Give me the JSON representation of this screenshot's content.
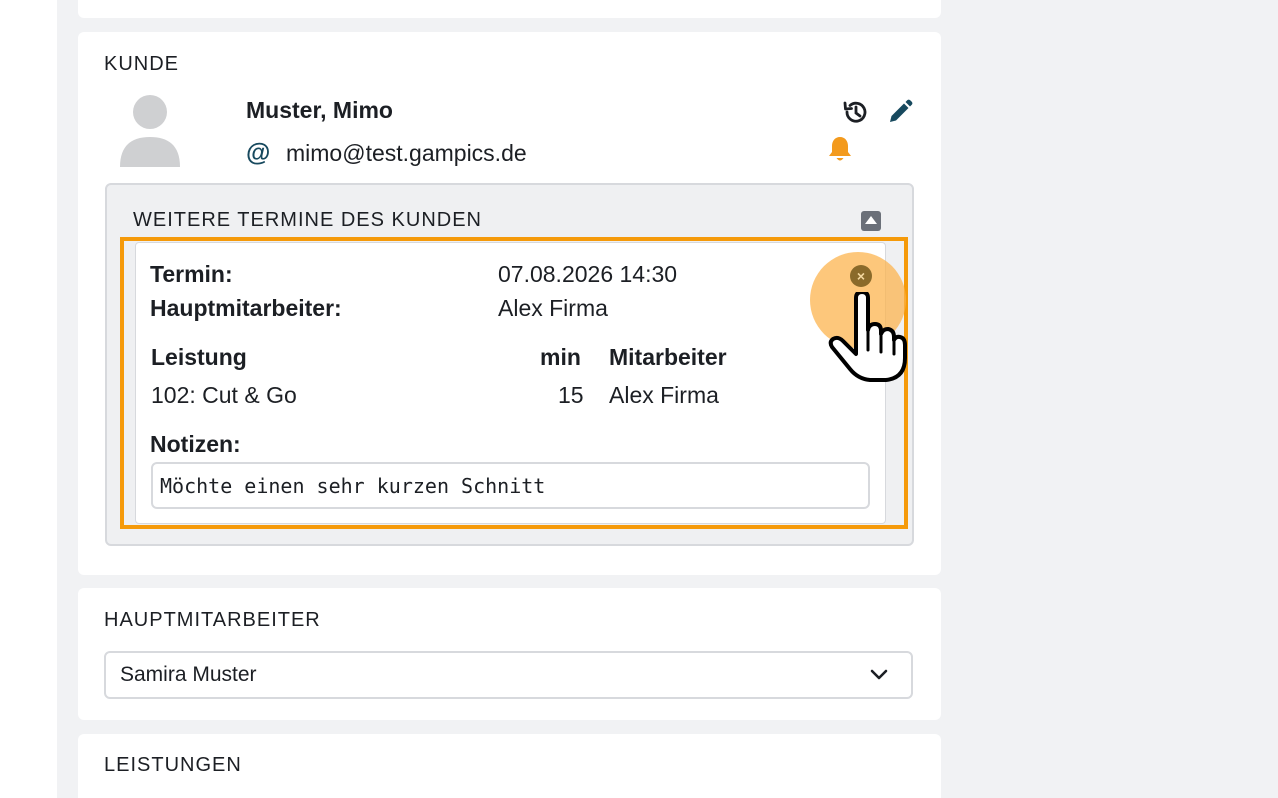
{
  "kunde": {
    "section_title": "KUNDE",
    "name": "Muster, Mimo",
    "email_symbol": "@",
    "email": "mimo@test.gampics.de",
    "icons": [
      "history-icon",
      "edit-icon",
      "bell-icon",
      "avatar-icon"
    ],
    "bell_color": "#f39a1d"
  },
  "weitere": {
    "title": "WEITERE TERMINE DES KUNDEN",
    "appointment": {
      "termin_label": "Termin:",
      "termin_value": "07.08.2026 14:30",
      "haupt_label": "Hauptmitarbeiter:",
      "haupt_value": "Alex Firma",
      "table": {
        "headers": [
          "Leistung",
          "min",
          "Mitarbeiter"
        ],
        "rows": [
          [
            "102: Cut & Go",
            "15",
            "Alex Firma"
          ]
        ]
      },
      "notes_label": "Notizen:",
      "notes_value": "Möchte einen sehr kurzen Schnitt",
      "close_symbol": "×"
    }
  },
  "hauptmitarbeiter": {
    "section_title": "HAUPTMITARBEITER",
    "selected": "Samira Muster"
  },
  "leistungen": {
    "section_title": "LEISTUNGEN"
  },
  "highlight_color": "#f59a0a"
}
